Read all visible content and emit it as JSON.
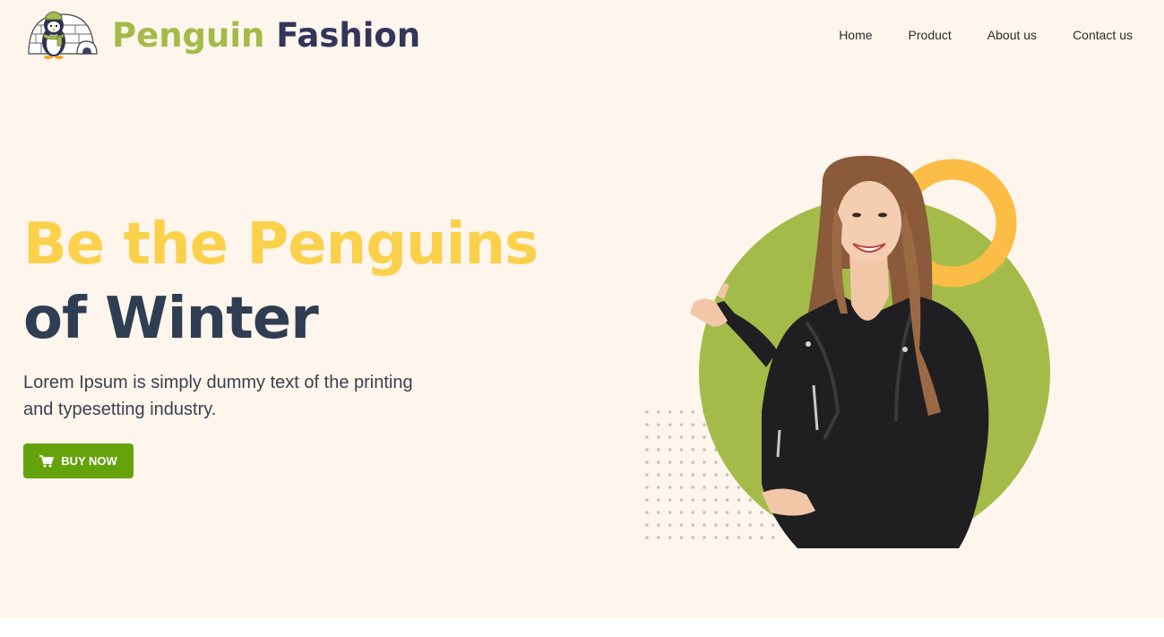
{
  "brand": {
    "part1": "Penguin",
    "part2": "Fashion",
    "logo_icon": "penguin-igloo-icon"
  },
  "nav": {
    "items": [
      {
        "label": "Home"
      },
      {
        "label": "Product"
      },
      {
        "label": "About us"
      },
      {
        "label": "Contact us"
      }
    ]
  },
  "hero": {
    "headline_line1": "Be the Penguins",
    "headline_line2": "of Winter",
    "description": "Lorem Ipsum is simply dummy text of the printing and typesetting industry.",
    "button_label": "BUY NOW",
    "button_icon": "cart-icon",
    "image_subject": "smiling woman in black leather jacket"
  },
  "colors": {
    "background": "#fef5ec",
    "brand_green": "#a4bb4a",
    "brand_navy": "#33365a",
    "headline_yellow": "#fbd14b",
    "headline_dark": "#2f3e53",
    "button_green": "#65a30d",
    "circle_green": "#a4bb4a",
    "ring_orange": "#fbbd45"
  }
}
